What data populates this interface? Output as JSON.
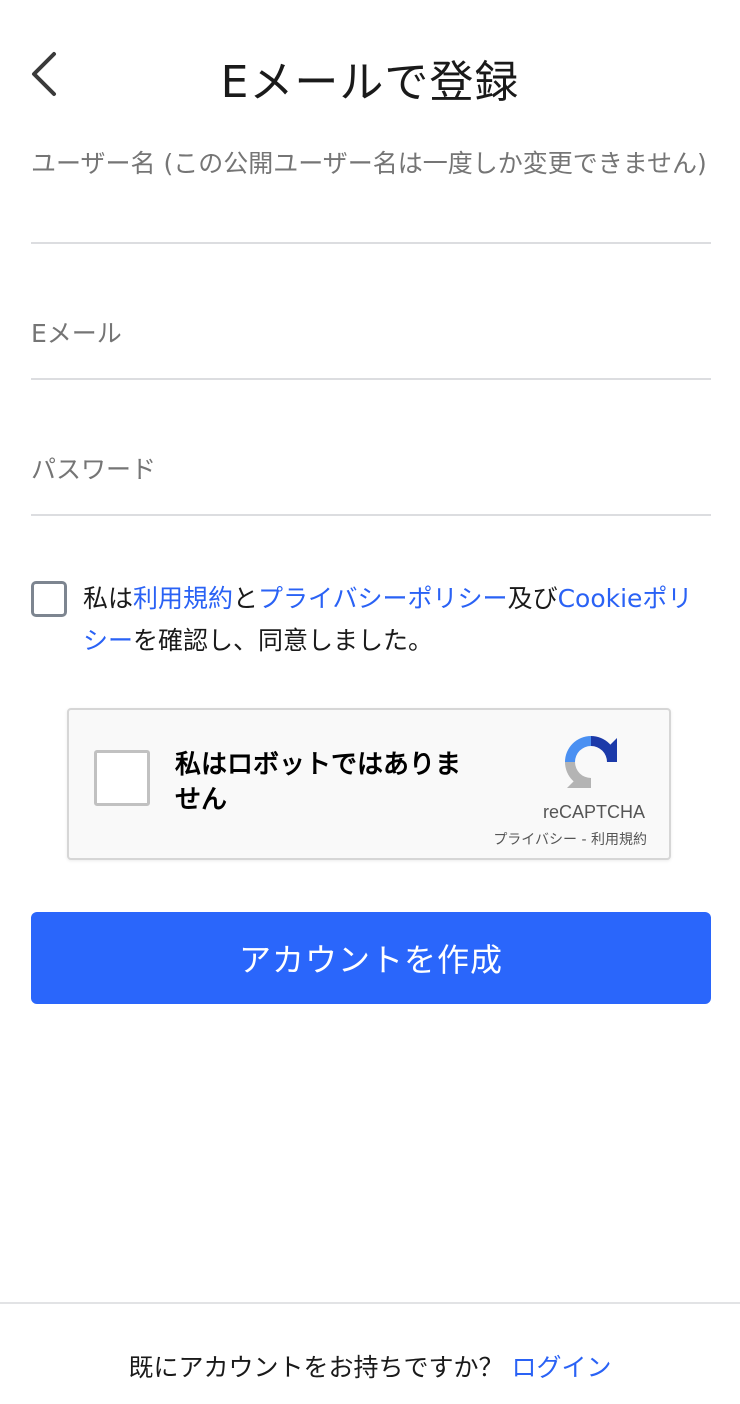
{
  "header": {
    "title": "Eメールで登録",
    "back_icon": "chevron-left-icon"
  },
  "form": {
    "username_placeholder": "ユーザー名 (この公開ユーザー名は一度しか変更できません)",
    "email_placeholder": "Eメール",
    "password_placeholder": "パスワード"
  },
  "consent": {
    "checked": false,
    "prefix": "私は",
    "terms_link": "利用規約",
    "and": "と",
    "privacy_link": "プライバシーポリシー",
    "conj": "及び",
    "cookie_link": "Cookieポリシー",
    "suffix": "を確認し、同意しました。"
  },
  "recaptcha": {
    "label": "私はロボットではありません",
    "brand": "reCAPTCHA",
    "privacy_link": "プライバシー",
    "separator": " - ",
    "terms_link": "利用規約",
    "logo_icon": "recaptcha-logo-icon"
  },
  "actions": {
    "create_account": "アカウントを作成"
  },
  "footer": {
    "question": "既にアカウントをお持ちですか？ ",
    "login_link": "ログイン"
  },
  "colors": {
    "accent": "#2a66fb",
    "link": "#2a62f5",
    "divider": "#dcdde0",
    "placeholder": "#8a8d91"
  }
}
